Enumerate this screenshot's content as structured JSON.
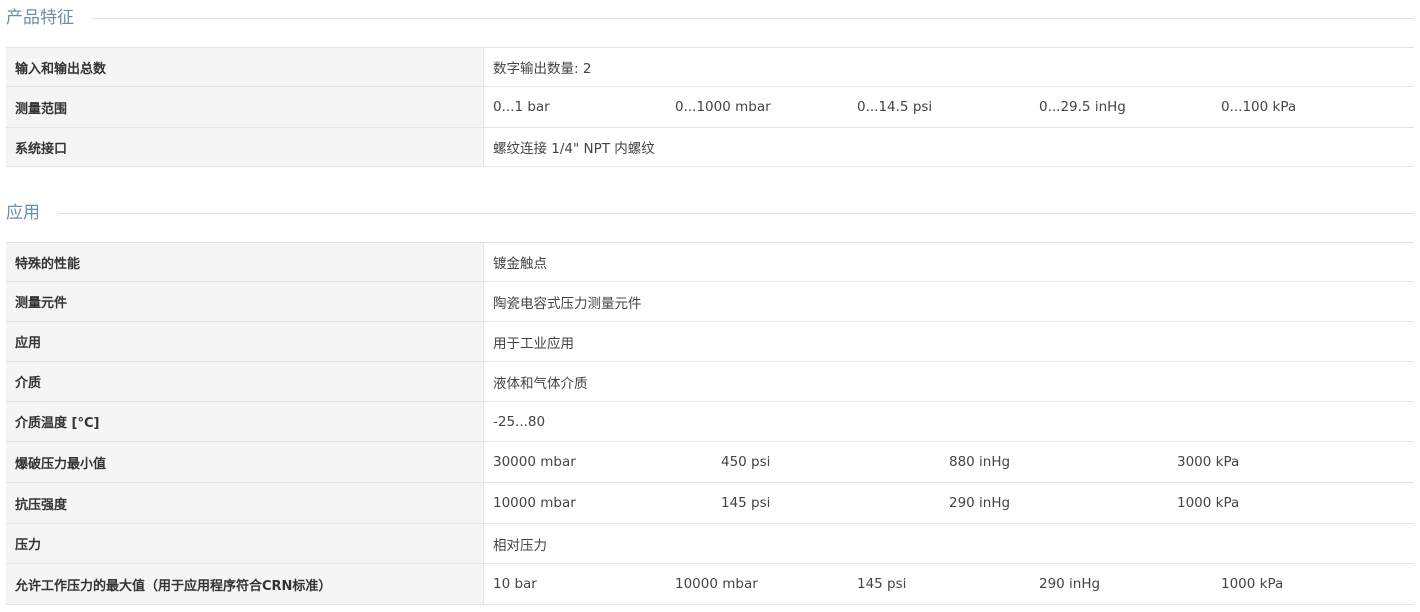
{
  "product_features": {
    "title": "产品特征",
    "rows": [
      {
        "label": "输入和输出总数",
        "values": [
          "数字输出数量: 2"
        ]
      },
      {
        "label": "测量范围",
        "values": [
          "0...1 bar",
          "0...1000 mbar",
          "0...14.5 psi",
          "0...29.5 inHg",
          "0...100 kPa"
        ]
      },
      {
        "label": "系统接口",
        "values": [
          "螺纹连接 1/4\" NPT 内螺纹"
        ]
      }
    ]
  },
  "application": {
    "title": "应用",
    "rows": [
      {
        "label": "特殊的性能",
        "values": [
          "镀金触点"
        ]
      },
      {
        "label": "测量元件",
        "values": [
          "陶瓷电容式压力测量元件"
        ]
      },
      {
        "label": "应用",
        "values": [
          "用于工业应用"
        ]
      },
      {
        "label": "介质",
        "values": [
          "液体和气体介质"
        ]
      },
      {
        "label": "介质温度 [°C]",
        "values": [
          "-25...80"
        ]
      },
      {
        "label": "爆破压力最小值",
        "values": [
          "30000 mbar",
          "450 psi",
          "880 inHg",
          "3000 kPa"
        ]
      },
      {
        "label": "抗压强度",
        "values": [
          "10000 mbar",
          "145 psi",
          "290 inHg",
          "1000 kPa"
        ]
      },
      {
        "label": "压力",
        "values": [
          "相对压力"
        ]
      },
      {
        "label": "允许工作压力的最大值（用于应用程序符合CRN标准）",
        "values": [
          "10 bar",
          "10000 mbar",
          "145 psi",
          "290 inHg",
          "1000 kPa"
        ]
      }
    ]
  }
}
